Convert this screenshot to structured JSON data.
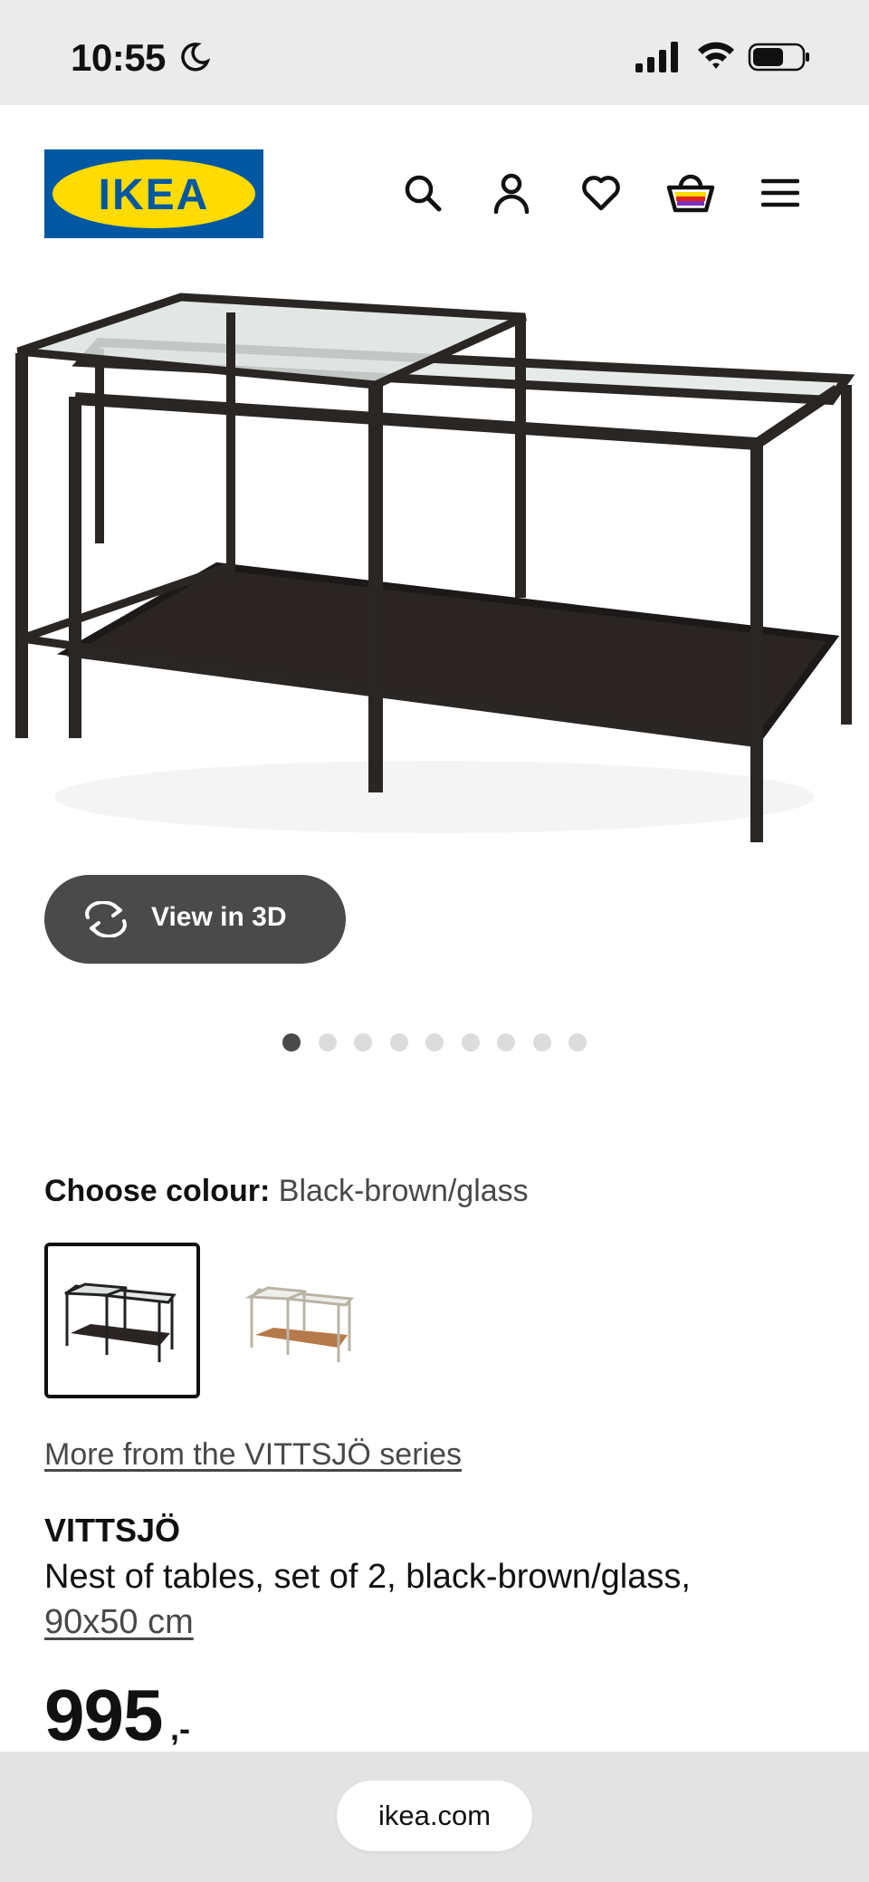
{
  "status_bar": {
    "time": "10:55",
    "icons": [
      "moon-icon",
      "signal-icon",
      "wifi-icon",
      "battery-icon"
    ]
  },
  "header": {
    "logo_text": "IKEA",
    "logo_colors": {
      "background": "#0058A3",
      "text": "#FFDB00"
    },
    "nav_icons": [
      "search-icon",
      "user-icon",
      "heart-icon",
      "basket-icon",
      "menu-icon"
    ]
  },
  "gallery": {
    "view_3d_label": "View in 3D",
    "dot_count": 9,
    "active_dot_index": 0
  },
  "colour": {
    "label": "Choose colour:",
    "value": "Black-brown/glass",
    "options": [
      "Black-brown/glass",
      "white/oak"
    ],
    "selected_index": 0
  },
  "series_link": "More from the VITTSJÖ series",
  "product": {
    "name": "VITTSJÖ",
    "description": "Nest of tables, set of 2, black-brown/glass,",
    "size": "90x50 cm",
    "price": "995",
    "price_suffix": ",-"
  },
  "browser": {
    "url": "ikea.com"
  },
  "colors": {
    "accent_dark": "#484848",
    "status_bar_bg": "#EBEBEB",
    "url_bar_bg": "#E3E3E3"
  }
}
